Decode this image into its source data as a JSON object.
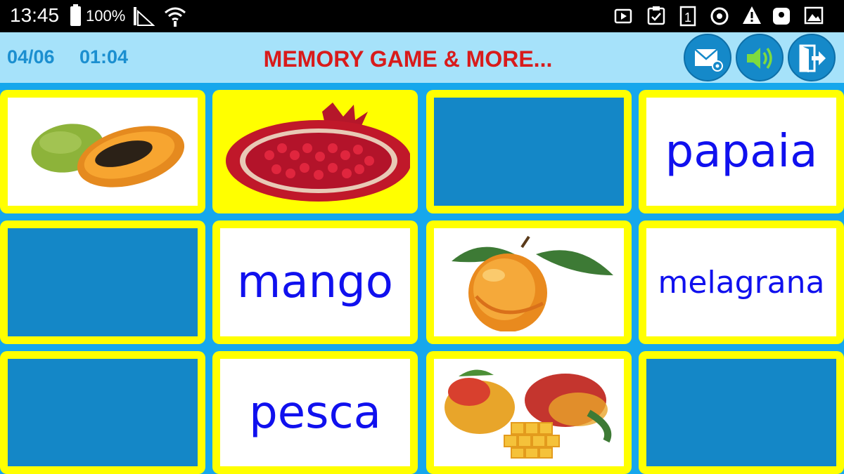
{
  "status_bar": {
    "time": "13:45",
    "battery": "100%",
    "icons": [
      "signal-icon",
      "wifi-icon",
      "video-icon",
      "clipboard-check-icon",
      "sim-1-icon",
      "power-icon",
      "warning-icon",
      "galaxy-icon",
      "image-icon"
    ]
  },
  "header": {
    "counter": "04/06",
    "timer": "01:04",
    "title": "MEMORY GAME & MORE...",
    "buttons": [
      "mail-settings-icon",
      "sound-icon",
      "exit-icon"
    ]
  },
  "board": {
    "cards": [
      {
        "state": "picture",
        "fruit": "papaya-icon"
      },
      {
        "state": "picture",
        "fruit": "pomegranate-icon"
      },
      {
        "state": "hidden"
      },
      {
        "state": "word",
        "text": "papaia"
      },
      {
        "state": "hidden"
      },
      {
        "state": "word",
        "text": "mango"
      },
      {
        "state": "picture",
        "fruit": "peach-icon"
      },
      {
        "state": "word",
        "text": "melagrana"
      },
      {
        "state": "hidden"
      },
      {
        "state": "word",
        "text": "pesca"
      },
      {
        "state": "picture",
        "fruit": "mango-icon"
      },
      {
        "state": "hidden"
      }
    ]
  },
  "colors": {
    "board_bg": "#16a7ec",
    "card_frame": "#ffff00",
    "card_back": "#1487c7",
    "word_text": "#1010ee",
    "title_text": "#d81b1b",
    "header_bg": "#a6e2fa"
  }
}
